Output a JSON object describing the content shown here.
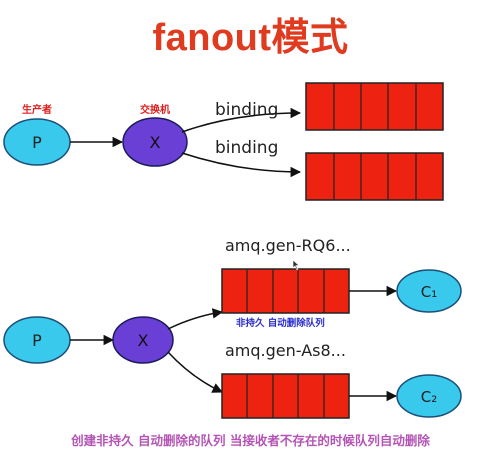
{
  "title": "fanout模式",
  "top": {
    "producer_label": "生产者",
    "exchange_label": "交换机",
    "producer": "P",
    "exchange": "X",
    "binding_1": "binding",
    "binding_2": "binding"
  },
  "bottom": {
    "producer": "P",
    "exchange": "X",
    "queue_1_name": "amq.gen-RQ6...",
    "queue_2_name": "amq.gen-As8...",
    "queue_note": "非持久 自动删除队列",
    "consumer_1": "C₁",
    "consumer_2": "C₂"
  },
  "note": "创建非持久 自动删除的队列 当接收者不存在的时候队列自动删除",
  "colors": {
    "title": "#e03a1f",
    "producer": "#39c9ec",
    "exchange": "#6a3fd6",
    "queue": "#ee2211",
    "label_red": "#e02020",
    "label_blue": "#2b2ecb",
    "note": "#b455b5"
  }
}
